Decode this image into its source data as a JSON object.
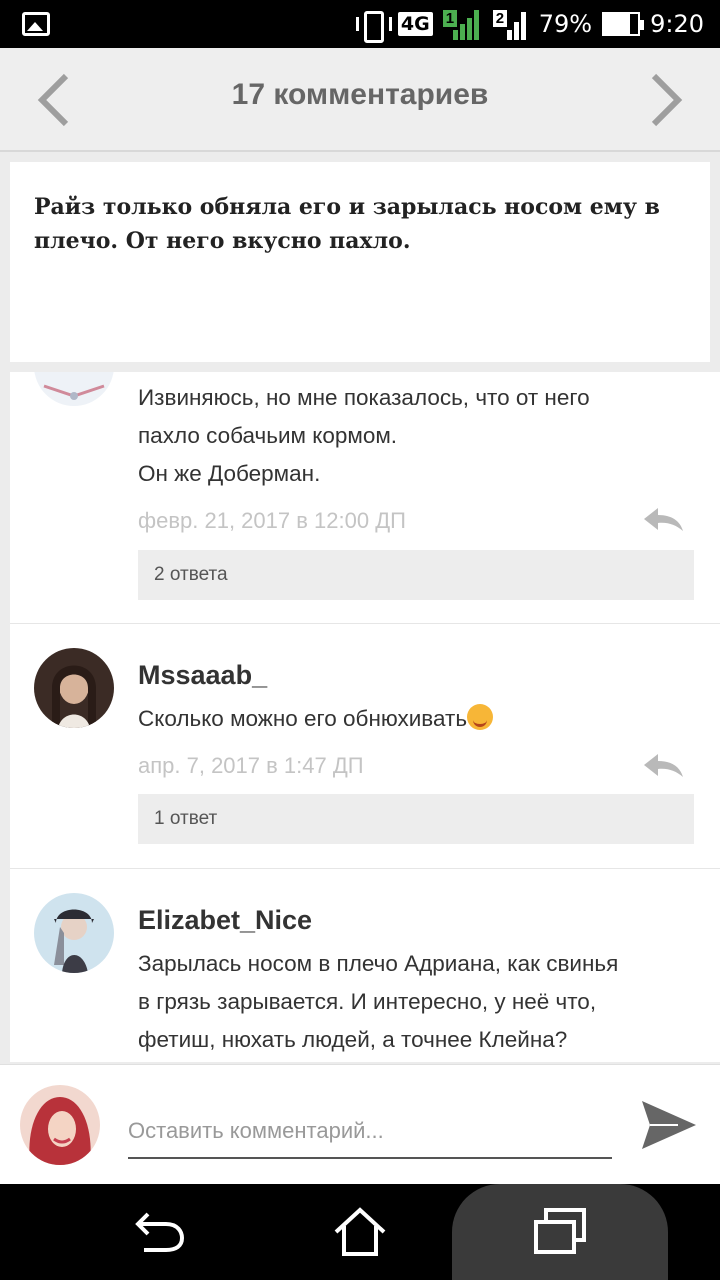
{
  "status_bar": {
    "network": "4G",
    "signal_sim1": "1",
    "signal_sim2": "2",
    "battery": "79%",
    "time": "9:20"
  },
  "header": {
    "title": "17 комментариев",
    "prev_icon": "chevron-left-icon",
    "next_icon": "chevron-right-icon"
  },
  "quote": {
    "text": "Райз только обняла его и зарылась носом ему в плечо. От него вкусно пахло."
  },
  "comments": [
    {
      "username": "",
      "lines": [
        "Извиняюсь, но мне показалось, что от него",
        "пахло собачьим кормом.",
        "Он же Доберман."
      ],
      "date": "февр. 21, 2017 в 12:00 ДП",
      "replies": "2 ответа"
    },
    {
      "username": "Mssaaab_",
      "lines": [
        "Сколько можно его обнюхивать"
      ],
      "date": "апр. 7, 2017 в 1:47 ДП",
      "replies": "1 ответ"
    },
    {
      "username": "Elizabet_Nice",
      "lines": [
        "Зарылась носом в плечо Адриана, как свинья",
        "в грязь зарывается. И интересно, у неё что,",
        "фетиш, нюхать людей, а точнее Клейна?"
      ],
      "date": "",
      "replies": ""
    }
  ],
  "composer": {
    "placeholder": "Оставить комментарий..."
  },
  "colors": {
    "accent_signal": "#4caf50",
    "header_bg": "#eeeeee",
    "reply_bg": "#ededed"
  }
}
